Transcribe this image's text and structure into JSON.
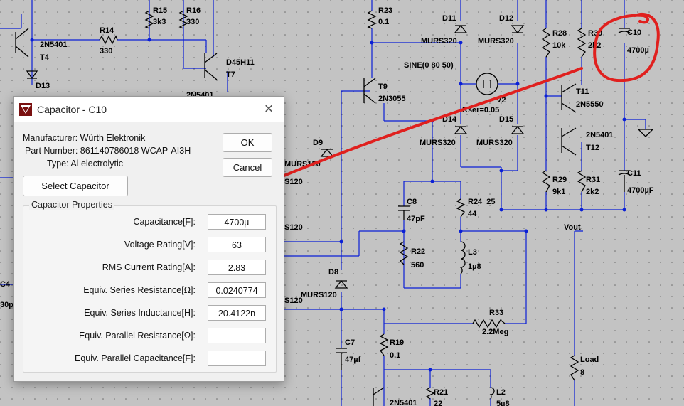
{
  "schematic": {
    "labels": {
      "r15": "R15",
      "r15_val": "3k3",
      "r16": "R16",
      "r16_val": "330",
      "r23": "R23",
      "r23_val": "0.1",
      "d11": "D11",
      "d11_val": "MURS320",
      "d12": "D12",
      "d12_val": "MURS320",
      "r28": "R28",
      "r28_val": "10k",
      "r30": "R30",
      "r30_val": "2k2",
      "c10": "C10",
      "c10_val": "4700µ",
      "t4_type": "2N5401",
      "t4": "T4",
      "r14": "R14",
      "r14_val": "330",
      "t7_type": "D45H11",
      "t7": "T7",
      "sine": "SINE(0 80 50)",
      "d13": "D13",
      "t9": "T9",
      "t9_type": "2N3055",
      "t7b_type": "2N5401",
      "v2": "V2",
      "rser": "Rser=0.05",
      "t11": "T11",
      "t11_type": "2N5550",
      "d14": "D14",
      "d15": "D15",
      "d9": "D9",
      "murs320_c": "MURS320",
      "murs320_d": "MURS320",
      "t12_type": "2N5401",
      "t12": "T12",
      "murs120_a": "MURS120",
      "s120_a": "S120",
      "r29": "R29",
      "r29_val": "9k1",
      "r31": "R31",
      "r31_val": "2k2",
      "c11": "C11",
      "c11_val": "4700µF",
      "c8": "C8",
      "c8_val": "47pF",
      "r24": "R24_25",
      "r24_val": "44",
      "vout": "Vout",
      "s120_b": "S120",
      "r22": "R22",
      "r22_val": "560",
      "l3": "L3",
      "l3_val": "1µ8",
      "c4": "C4",
      "c4_val": "30p",
      "d8": "D8",
      "murs120_b": "MURS120",
      "s120_c": "S120",
      "r33": "R33",
      "r33_val": "2.2Meg",
      "c7": "C7",
      "c7_val": "47µf",
      "r19": "R19",
      "r19_val": "0.1",
      "load": "Load",
      "load_val": "8",
      "r21": "R21",
      "r21_val": "22",
      "l2": "L2",
      "l2_val": "5µ8",
      "t_bottom": "2N5401"
    }
  },
  "dialog": {
    "title": "Capacitor - C10",
    "close": "×",
    "manufacturer": "Manufacturer: Würth Elektronik",
    "part_number": "Part Number: 861140786018 WCAP-AI3H",
    "type": "Type: Al electrolytic",
    "ok_label": "OK",
    "cancel_label": "Cancel",
    "select_label": "Select Capacitor",
    "group_title": "Capacitor Properties",
    "properties": [
      {
        "label": "Capacitance[F]:",
        "value": "4700µ"
      },
      {
        "label": "Voltage Rating[V]:",
        "value": "63"
      },
      {
        "label": "RMS Current Rating[A]:",
        "value": "2.83"
      },
      {
        "label": "Equiv. Series Resistance[Ω]:",
        "value": "0.0240774"
      },
      {
        "label": "Equiv. Series Inductance[H]:",
        "value": "20.4122n"
      },
      {
        "label": "Equiv. Parallel Resistance[Ω]:",
        "value": ""
      },
      {
        "label": "Equiv. Parallel Capacitance[F]:",
        "value": ""
      }
    ]
  },
  "annotation": {
    "color": "#e0201e"
  },
  "colors": {
    "wire": "#0a1fd6",
    "background": "#c3c3c3"
  }
}
